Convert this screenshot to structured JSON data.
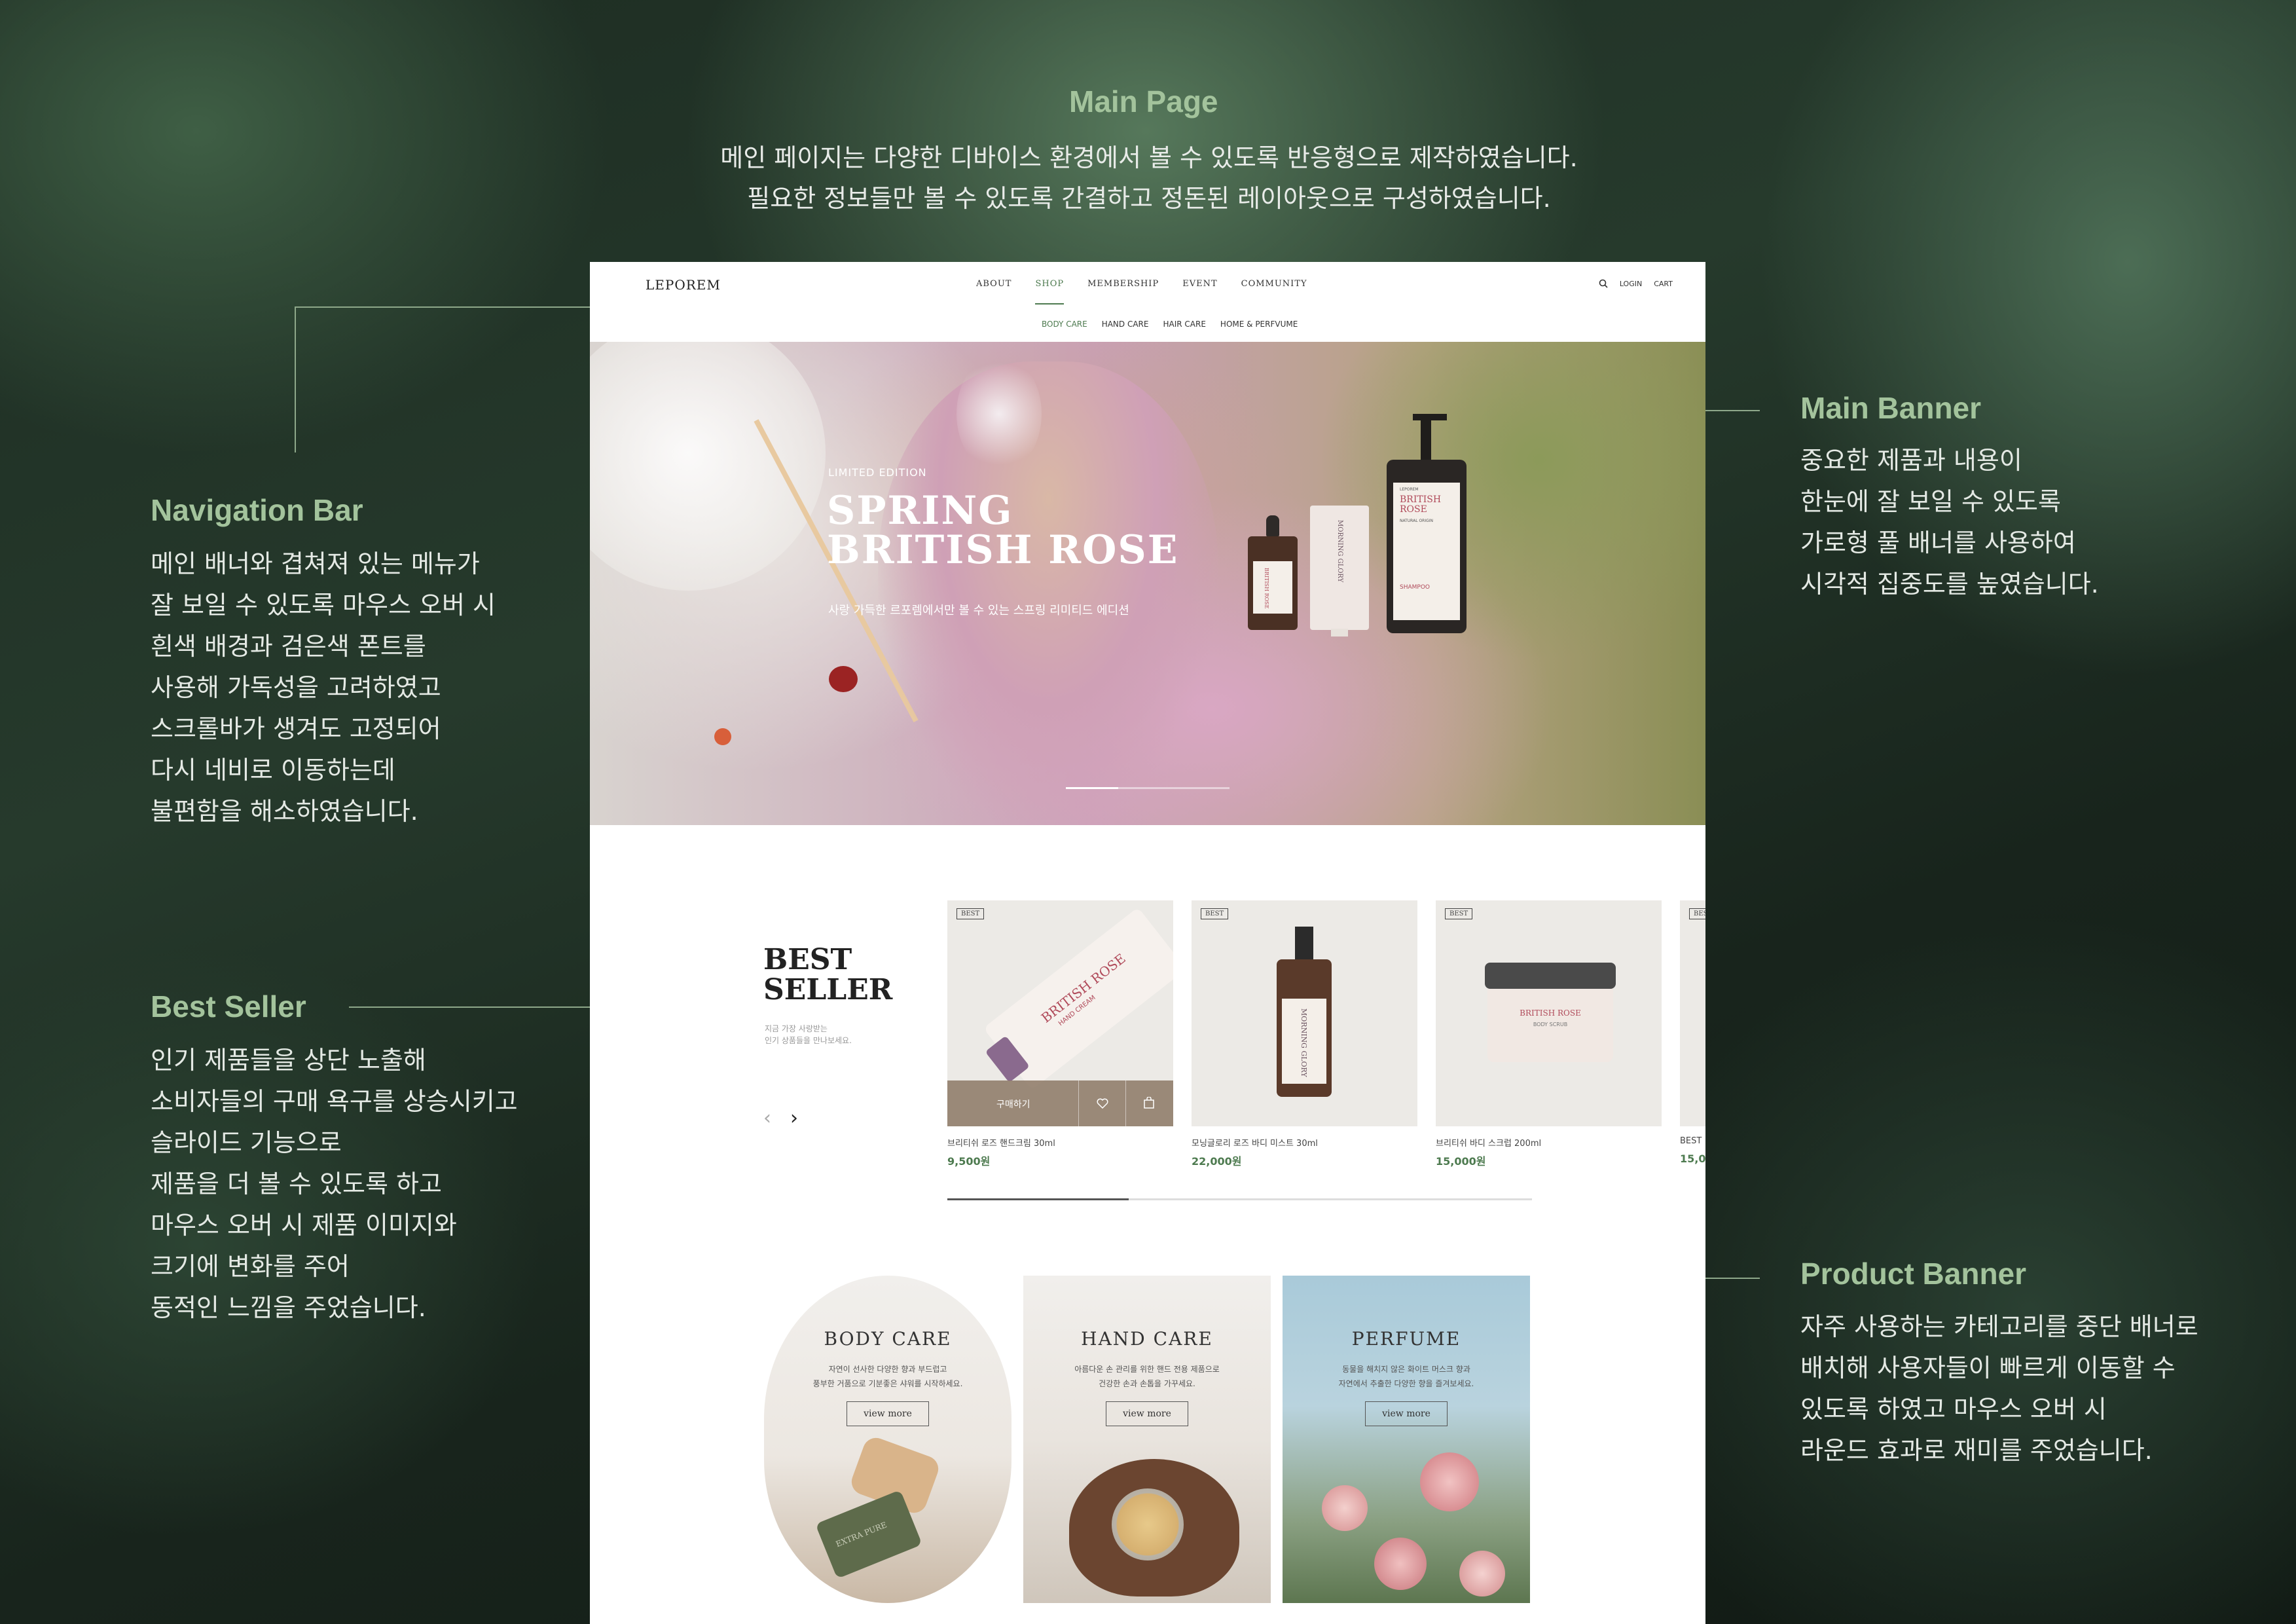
{
  "annotations": {
    "main_page": {
      "title": "Main Page",
      "text": "메인 페이지는 다양한 디바이스 환경에서 볼 수 있도록 반응형으로 제작하였습니다.\n필요한 정보들만 볼 수 있도록 간결하고 정돈된 레이아웃으로 구성하였습니다."
    },
    "navigation_bar": {
      "title": "Navigation Bar",
      "text": "메인 배너와 겹쳐져 있는 메뉴가\n잘 보일 수 있도록 마우스 오버 시\n흰색 배경과 검은색 폰트를\n사용해 가독성을 고려하였고\n스크롤바가 생겨도 고정되어\n다시 네비로 이동하는데\n불편함을 해소하였습니다."
    },
    "best_seller": {
      "title": "Best Seller",
      "text": "인기 제품들을 상단 노출해\n소비자들의 구매 욕구를 상승시키고\n슬라이드 기능으로\n제품을 더 볼 수 있도록 하고\n마우스 오버 시 제품 이미지와\n크기에 변화를 주어\n동적인 느낌을 주었습니다."
    },
    "main_banner": {
      "title": "Main Banner",
      "text": "중요한 제품과 내용이\n한눈에 잘 보일 수 있도록\n가로형 풀 배너를 사용하여\n시각적 집중도를 높였습니다."
    },
    "product_banner": {
      "title": "Product Banner",
      "text": "자주 사용하는 카테고리를 중단 배너로\n배치해 사용자들이 빠르게 이동할 수\n있도록 하였고 마우스 오버 시\n라운드 효과로 재미를 주었습니다."
    }
  },
  "site": {
    "logo": "LEPOREM",
    "menu": [
      "ABOUT",
      "SHOP",
      "MEMBERSHIP",
      "EVENT",
      "COMMUNITY"
    ],
    "active_menu": "SHOP",
    "login": "LOGIN",
    "cart": "CART",
    "submenu": [
      "BODY CARE",
      "HAND CARE",
      "HAIR CARE",
      "HOME & PERFVUME"
    ]
  },
  "hero": {
    "tag": "LIMITED EDITION",
    "title_line1": "SPRING",
    "title_line2": "BRITISH ROSE",
    "subtitle": "사랑 가득한 르포렘에서만 볼 수 있는 스프링 리미티드 에디션",
    "products": {
      "shampoo_brand": "LEPOREM",
      "shampoo_name": "BRITISH ROSE",
      "shampoo_sub": "NATURAL ORIGIN",
      "shampoo_type": "SHAMPOO",
      "tube_name": "MORNING GLORY",
      "dropper_name": "BRITISH ROSE"
    },
    "slide_progress": 0.32
  },
  "best_seller": {
    "title_line1": "BEST",
    "title_line2": "SELLER",
    "subtitle": "지금 가장 사랑받는\n인기 상품들을 만나보세요.",
    "prev": "‹",
    "next": "›",
    "badge": "BEST",
    "buy_label": "구매하기",
    "items": [
      {
        "name": "브리티쉬 로즈 핸드크림 30ml",
        "price": "9,500원",
        "product_label": "BRITISH ROSE",
        "product_type": "HAND CREAM"
      },
      {
        "name": "모닝글로리 로즈 바디 미스트 30ml",
        "price": "22,000원",
        "product_label": "MORNING GLORY"
      },
      {
        "name": "브리티쉬 바디 스크럽 200ml",
        "price": "15,000원",
        "product_label": "BRITISH ROSE",
        "product_type": "BODY SCRUB"
      },
      {
        "name": "BEST",
        "price": "15,0"
      }
    ],
    "slider_progress": 0.31
  },
  "categories": [
    {
      "title": "BODY CARE",
      "text": "자연이 선사한 다양한 향과 부드럽고\n풍부한 거품으로 기분좋은 샤워를 시작하세요.",
      "button": "view more",
      "soap": "EXTRA PURE"
    },
    {
      "title": "HAND CARE",
      "text": "아름다운 손 관리를 위한 핸드 전용 제품으로\n건강한 손과 손톱을 가꾸세요.",
      "button": "view more"
    },
    {
      "title": "PERFUME",
      "text": "동물을 해치지 않은 화이트 머스크 향과\n자연에서 추출한 다양한 향을 즐겨보세요.",
      "button": "view more"
    }
  ],
  "colors": {
    "accent": "#4d7a4f",
    "annotation_title": "#a3c39c",
    "background": "#1d2c22"
  }
}
